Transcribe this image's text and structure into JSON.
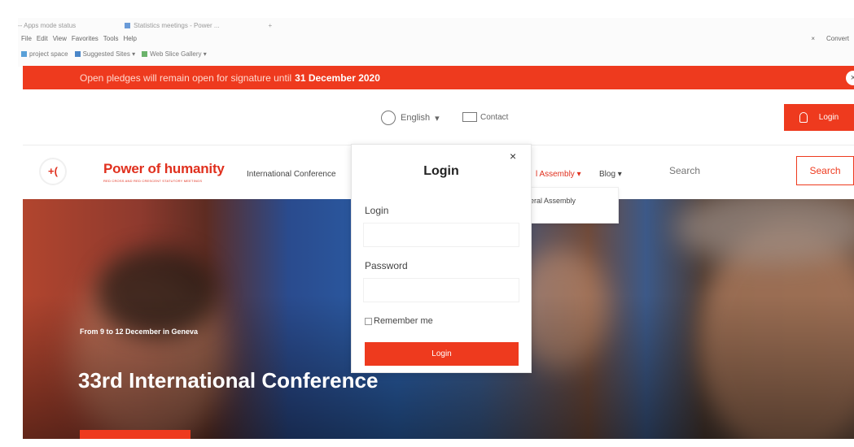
{
  "browser": {
    "tabs": [
      "-- Apps mode status",
      "Statistics meetings - Power ...",
      "+"
    ],
    "menu": [
      "File",
      "Edit",
      "View",
      "Favorites",
      "Tools",
      "Help"
    ],
    "right_items": [
      "×",
      "Convert"
    ],
    "favorites": [
      "project space",
      "Suggested Sites ▾",
      "Web Slice Gallery ▾"
    ]
  },
  "banner": {
    "text": "Open pledges will remain open for signature until",
    "date": "31 December 2020",
    "close": "×"
  },
  "topbar": {
    "language": "English",
    "language_caret": "▾",
    "contact": "Contact",
    "login": "Login"
  },
  "nav": {
    "logo_mark": "+(",
    "logo_title": "Power of humanity",
    "logo_subtitle": "RED CROSS AND RED CRESCENT STATUTORY MEETINGS",
    "international_conference": "International Conference",
    "general_assembly": "l Assembly ▾",
    "blog": "Blog ▾",
    "search_placeholder": "Search",
    "search_button": "Search",
    "dropdown_item": "eral Assembly"
  },
  "hero": {
    "dates": "From 9 to 12 December in Geneva",
    "title": "33rd International Conference"
  },
  "login_modal": {
    "close": "×",
    "title": "Login",
    "login_label": "Login",
    "password_label": "Password",
    "remember": "Remember me",
    "submit": "Login"
  },
  "colors": {
    "accent": "#ee3a1e"
  }
}
